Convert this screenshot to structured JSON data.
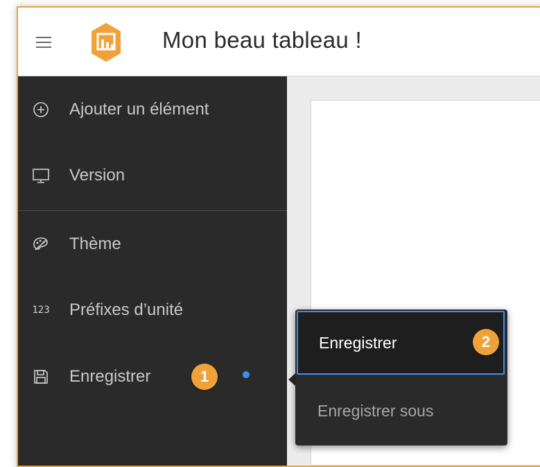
{
  "header": {
    "title": "Mon beau tableau !"
  },
  "sidebar": {
    "items": [
      {
        "label": "Ajouter un élément",
        "icon": "plus-circle-icon"
      },
      {
        "label": "Version",
        "icon": "monitor-icon"
      },
      {
        "label": "Thème",
        "icon": "palette-icon"
      },
      {
        "label": "Préfixes d’unité",
        "icon": "123-icon",
        "icon_text": "123"
      },
      {
        "label": "Enregistrer",
        "icon": "save-icon"
      }
    ]
  },
  "popup_menu": {
    "items": [
      {
        "label": "Enregistrer"
      },
      {
        "label": "Enregistrer sous"
      }
    ]
  },
  "callouts": {
    "step1": "1",
    "step2": "2"
  },
  "colors": {
    "accent": "#f0a23a",
    "focus": "#3b8ff0",
    "sidebar_bg": "#2a2a2a"
  }
}
